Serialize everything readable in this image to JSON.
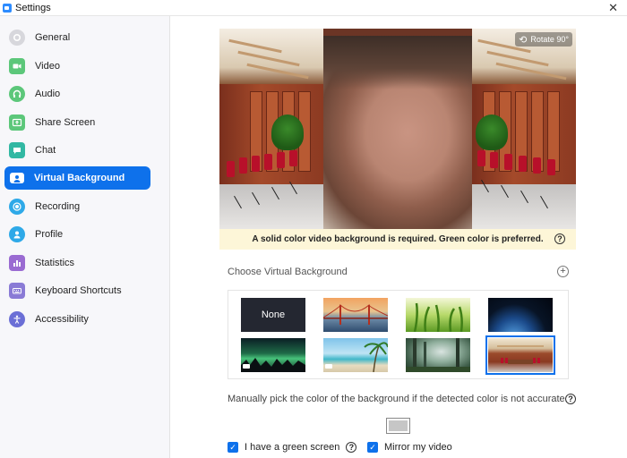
{
  "window": {
    "title": "Settings",
    "close_glyph": "✕"
  },
  "sidebar": {
    "items": [
      {
        "label": "General",
        "icon": "gear-icon",
        "color": "#d7d7dc"
      },
      {
        "label": "Video",
        "icon": "video-camera-icon",
        "color": "#5cc77a"
      },
      {
        "label": "Audio",
        "icon": "headphones-icon",
        "color": "#5cc77a"
      },
      {
        "label": "Share Screen",
        "icon": "share-screen-icon",
        "color": "#5cc77a"
      },
      {
        "label": "Chat",
        "icon": "chat-bubble-icon",
        "color": "#32b8a3"
      },
      {
        "label": "Virtual Background",
        "icon": "virtual-background-icon",
        "color": "#0e71eb",
        "active": true
      },
      {
        "label": "Recording",
        "icon": "recording-icon",
        "color": "#2ea9e8"
      },
      {
        "label": "Profile",
        "icon": "profile-icon",
        "color": "#2ea9e8"
      },
      {
        "label": "Statistics",
        "icon": "statistics-icon",
        "color": "#9a6bd2"
      },
      {
        "label": "Keyboard Shortcuts",
        "icon": "keyboard-icon",
        "color": "#8a7bd6"
      },
      {
        "label": "Accessibility",
        "icon": "accessibility-icon",
        "color": "#6b6fd6"
      }
    ]
  },
  "preview": {
    "rotate_label": "Rotate 90°",
    "notice": "A solid color video background is required. Green color is preferred.",
    "help_glyph": "?"
  },
  "backgrounds": {
    "title": "Choose Virtual Background",
    "add_glyph": "+",
    "items": [
      {
        "label": "None",
        "kind": "none"
      },
      {
        "kind": "golden-gate"
      },
      {
        "kind": "grass"
      },
      {
        "kind": "earth-space"
      },
      {
        "kind": "aurora",
        "video": true
      },
      {
        "kind": "beach",
        "video": true
      },
      {
        "kind": "forest"
      },
      {
        "kind": "conference-room",
        "selected": true
      }
    ]
  },
  "manual": {
    "text": "Manually pick the color of the background if the detected color is not accurate.",
    "help_glyph": "?",
    "swatch_color": "#c6c6c6"
  },
  "options": {
    "green_screen": {
      "label": "I have a green screen",
      "checked": true,
      "help_glyph": "?"
    },
    "mirror": {
      "label": "Mirror my video",
      "checked": true
    }
  },
  "colors": {
    "accent": "#0e71eb",
    "notice_bg": "#fdf6d8"
  }
}
